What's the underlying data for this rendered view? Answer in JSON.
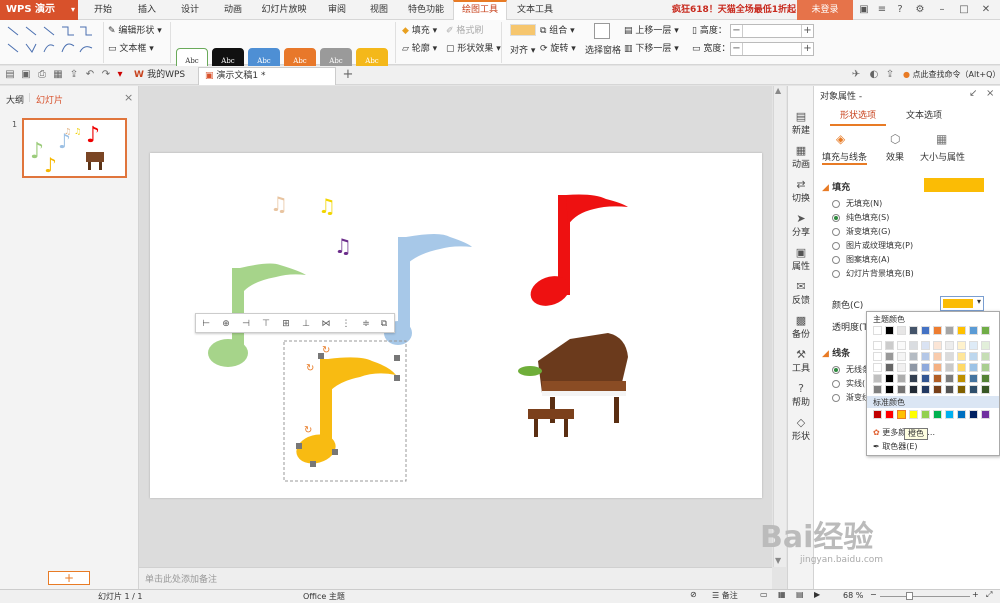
{
  "app": {
    "logo": "WPS 演示",
    "tabs": [
      "开始",
      "插入",
      "设计",
      "动画",
      "幻灯片放映",
      "审阅",
      "视图",
      "特色功能",
      "绘图工具",
      "文本工具"
    ],
    "active_tab": "绘图工具",
    "promo": "疯狂618！天猫全场最低1折起",
    "login": "未登录"
  },
  "ribbon": {
    "edit_shape": "编辑形状",
    "textbox": "文本框",
    "style_boxes": [
      {
        "label": "Abc",
        "bg": "#ffffff",
        "fg": "#333333",
        "border": "#6aaa5a"
      },
      {
        "label": "Abc",
        "bg": "#111111",
        "fg": "#ffffff",
        "border": "#111111"
      },
      {
        "label": "Abc",
        "bg": "#4e8fd4",
        "fg": "#ffffff",
        "border": "#4e8fd4"
      },
      {
        "label": "Abc",
        "bg": "#e8782a",
        "fg": "#ffffff",
        "border": "#e8782a"
      },
      {
        "label": "Abc",
        "bg": "#9a9a9a",
        "fg": "#ffffff",
        "border": "#9a9a9a"
      },
      {
        "label": "Abc",
        "bg": "#f4b81a",
        "fg": "#ffffff",
        "border": "#f4b81a"
      }
    ],
    "fill": "填充",
    "format_painter": "格式刷",
    "outline": "轮廓",
    "shape_effect": "形状效果",
    "align": "对齐",
    "group": "组合",
    "rotate": "旋转",
    "selection_pane": "选择窗格",
    "bring_forward": "上移一层",
    "send_backward": "下移一层",
    "height_label": "高度：",
    "width_label": "宽度："
  },
  "docbar": {
    "my_wps": "我的WPS",
    "doc_tab": "演示文稿1 *",
    "search_cmd": "点此查找命令（Alt+Q）"
  },
  "left": {
    "outline_tab": "大纲",
    "slides_tab": "幻灯片",
    "slide_number": "1",
    "add_label": "+"
  },
  "notes": "单击此处添加备注",
  "vtoolbar": [
    {
      "label": "新建",
      "icon": "new-icon"
    },
    {
      "label": "动画",
      "icon": "animation-icon"
    },
    {
      "label": "切换",
      "icon": "transition-icon"
    },
    {
      "label": "分享",
      "icon": "share-icon"
    },
    {
      "label": "属性",
      "icon": "property-icon"
    },
    {
      "label": "反馈",
      "icon": "feedback-icon"
    },
    {
      "label": "备份",
      "icon": "backup-icon"
    },
    {
      "label": "工具",
      "icon": "tools-icon"
    },
    {
      "label": "帮助",
      "icon": "help-icon"
    },
    {
      "label": "形状",
      "icon": "shape-icon"
    }
  ],
  "props": {
    "title": "对象属性 -",
    "tab_shape": "形状选项",
    "tab_text": "文本选项",
    "sub_fill_line": "填充与线条",
    "sub_effect": "效果",
    "sub_size": "大小与属性",
    "fill_header": "填充",
    "fill_color": "#fbbc05",
    "fill_options": [
      "无填充(N)",
      "纯色填充(S)",
      "渐变填充(G)",
      "图片或纹理填充(P)",
      "图案填充(A)",
      "幻灯片背景填充(B)"
    ],
    "color_label": "颜色(C)",
    "transparency_label": "透明度(T)",
    "line_header": "线条",
    "line_options": [
      "无线条",
      "实线(",
      "渐变线"
    ]
  },
  "colorpop": {
    "theme_title": "主题颜色",
    "std_title": "标准颜色",
    "more_colors": "更多颜色(M)...",
    "picker": "取色器(E)",
    "tooltip": "橙色",
    "theme_top": [
      "#ffffff",
      "#000000",
      "#e7e6e6",
      "#44546a",
      "#4472c4",
      "#ed7d31",
      "#a5a5a5",
      "#ffc000",
      "#5b9bd5",
      "#70ad47"
    ],
    "standard": [
      "#c00000",
      "#ff0000",
      "#ffc000",
      "#ffff00",
      "#92d050",
      "#00b050",
      "#00b0f0",
      "#0070c0",
      "#002060",
      "#7030a0"
    ]
  },
  "status": {
    "slide_info": "幻灯片 1 / 1",
    "theme": "Office 主题",
    "notes_btn": "备注",
    "zoom": "68 %"
  },
  "watermark": "Bai经验",
  "watermark_url": "jingyan.baidu.com"
}
